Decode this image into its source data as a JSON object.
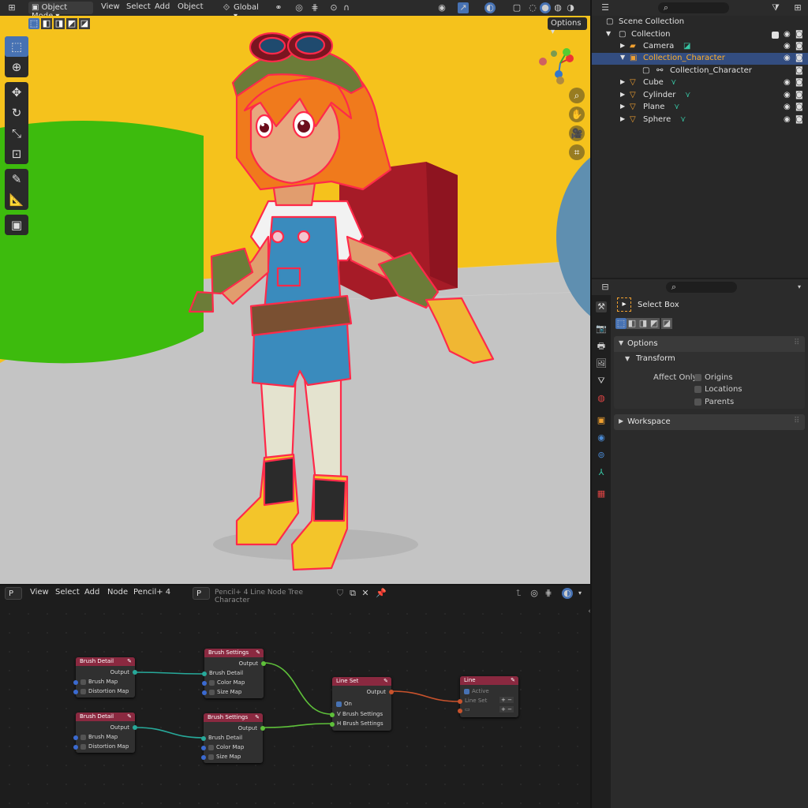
{
  "viewport_header": {
    "mode": "Object Mode",
    "menus": [
      "View",
      "Select",
      "Add",
      "Object"
    ],
    "orientation": "Global",
    "options_label": "Options"
  },
  "outliner": {
    "root": "Scene Collection",
    "rows": [
      {
        "label": "Collection"
      },
      {
        "label": "Camera"
      },
      {
        "label": "Collection_Character"
      },
      {
        "label": "Collection_Character"
      },
      {
        "label": "Cube"
      },
      {
        "label": "Cylinder"
      },
      {
        "label": "Plane"
      },
      {
        "label": "Sphere"
      }
    ]
  },
  "properties": {
    "tool_name": "Select Box",
    "options_panel": "Options",
    "transform_panel": "Transform",
    "affect_only_label": "Affect Only",
    "affect_items": [
      "Origins",
      "Locations",
      "Parents"
    ],
    "workspace_panel": "Workspace"
  },
  "node_editor": {
    "editor_type": "P",
    "menus": [
      "View",
      "Select",
      "Add",
      "Node"
    ],
    "tree_type": "Pencil+ 4",
    "tree_field_icon": "P",
    "tree_name": "Pencil+ 4 Line Node Tree Character",
    "nodes": {
      "brush_detail_1": {
        "title": "Brush Detail",
        "output": "Output",
        "rows": [
          "Brush Map",
          "Distortion Map"
        ]
      },
      "brush_detail_2": {
        "title": "Brush Detail",
        "output": "Output",
        "rows": [
          "Brush Map",
          "Distortion Map"
        ]
      },
      "brush_settings_1": {
        "title": "Brush Settings",
        "output": "Output",
        "rows": [
          "Brush Detail",
          "Color Map",
          "Size Map"
        ]
      },
      "brush_settings_2": {
        "title": "Brush Settings",
        "output": "Output",
        "rows": [
          "Brush Detail",
          "Color Map",
          "Size Map"
        ]
      },
      "line_set": {
        "title": "Line Set",
        "output": "Output",
        "on": "On",
        "v": "V Brush Settings",
        "h": "H Brush Settings"
      },
      "line": {
        "title": "Line",
        "active": "Active",
        "line_set": "Line Set"
      }
    }
  },
  "colors": {
    "accent": "#4772b3",
    "node_header": "#8a2940",
    "viewport_bg": "#f5c21c",
    "floor": "#c4c4c4",
    "green_cylinder": "#3dbb0d",
    "red_cube": "#a61b27",
    "selection_orange": "#f0a030"
  }
}
